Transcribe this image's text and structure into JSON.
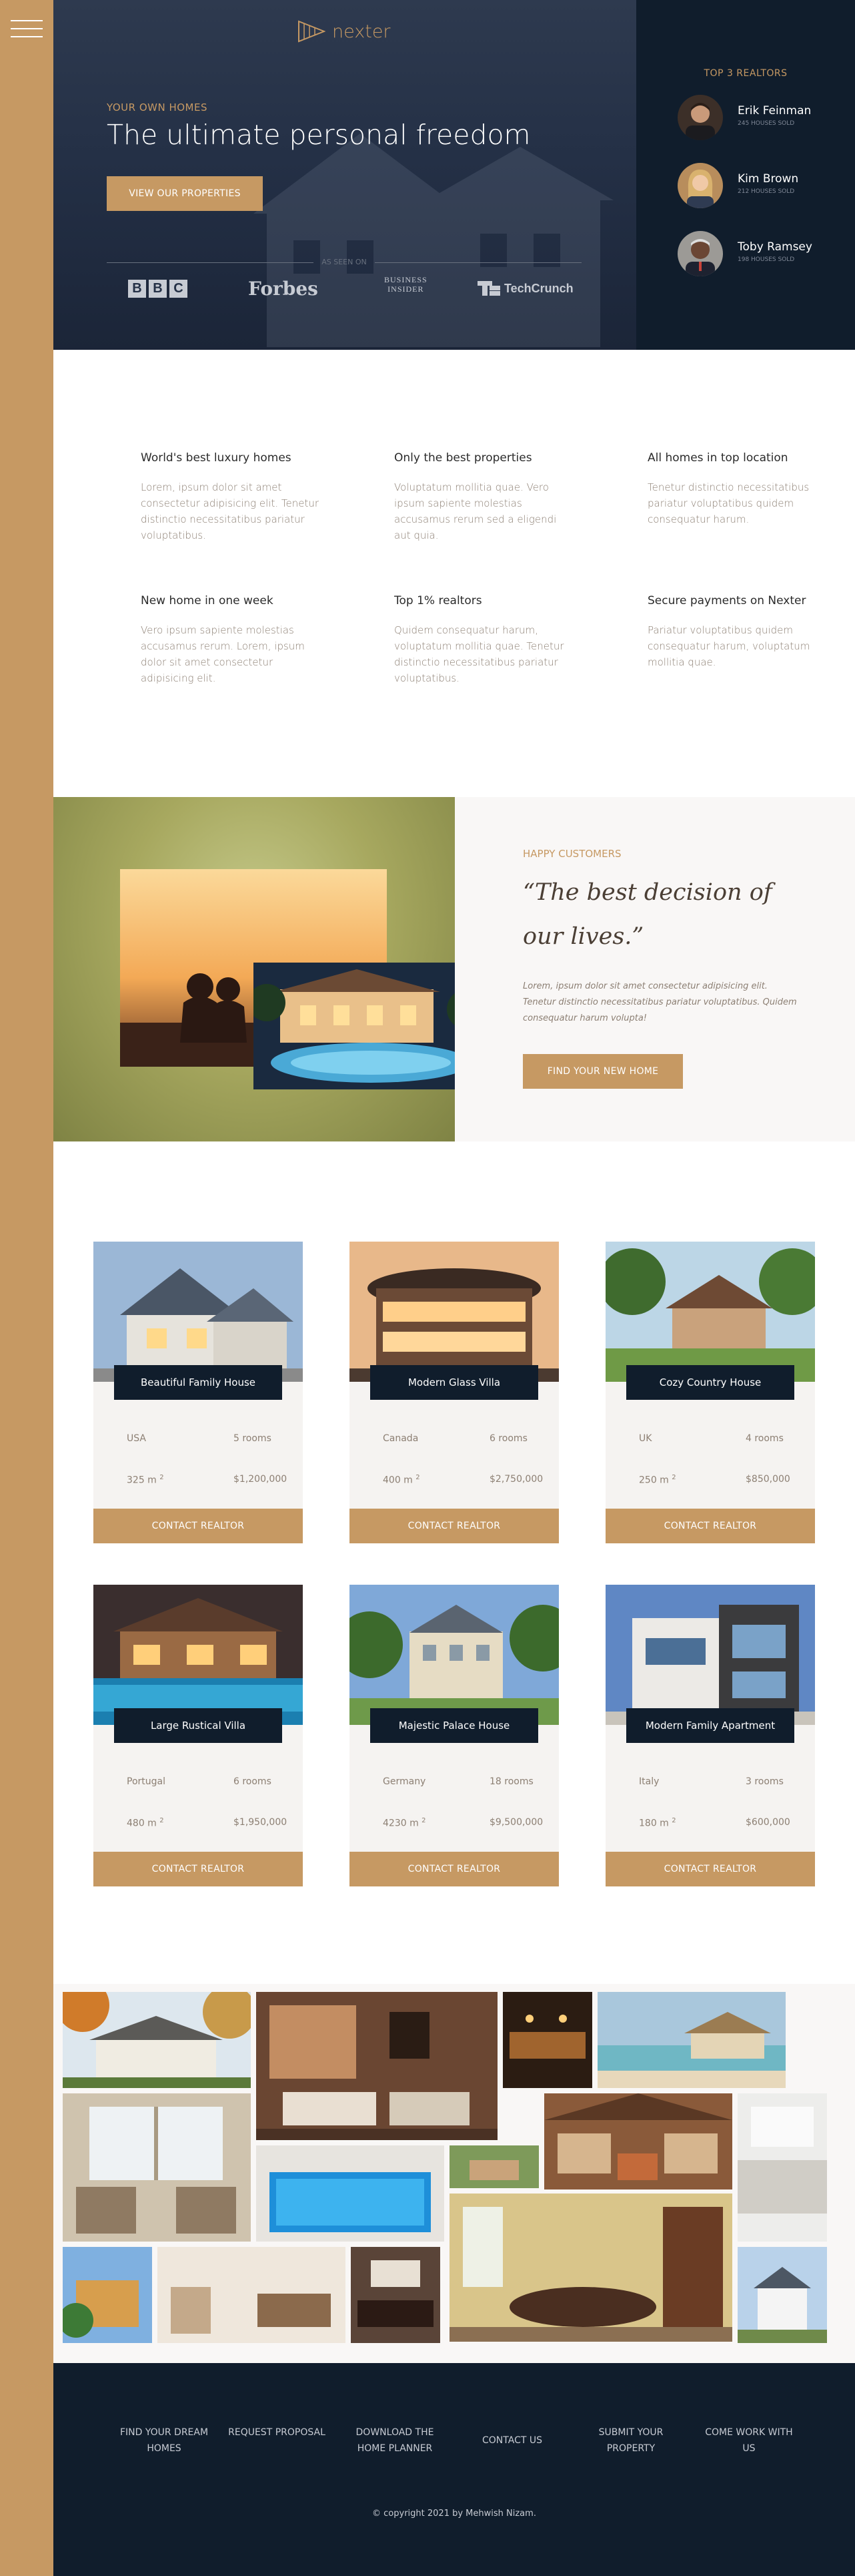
{
  "brand": {
    "name": "nexter",
    "accent": "#c69963",
    "dark": "#101d2c"
  },
  "header": {
    "tagline": "YOUR OWN HOMES",
    "title": "The ultimate personal freedom",
    "cta": "VIEW OUR PROPERTIES",
    "seen_on": "AS SEEN ON",
    "press": [
      "BBC",
      "Forbes",
      "BUSINESS INSIDER",
      "TechCrunch"
    ]
  },
  "realtors": {
    "title": "TOP 3 REALTORS",
    "list": [
      {
        "name": "Erik Feinman",
        "sold": "245 HOUSES SOLD"
      },
      {
        "name": "Kim Brown",
        "sold": "212 HOUSES SOLD"
      },
      {
        "name": "Toby Ramsey",
        "sold": "198 HOUSES SOLD"
      }
    ]
  },
  "features": [
    {
      "title": "World's best luxury homes",
      "text": "Lorem, ipsum dolor sit amet consectetur adipisicing elit. Tenetur distinctio necessitatibus pariatur voluptatibus."
    },
    {
      "title": "Only the best properties",
      "text": "Voluptatum mollitia quae. Vero ipsum sapiente molestias accusamus rerum sed a eligendi aut quia."
    },
    {
      "title": "All homes in top location",
      "text": "Tenetur distinctio necessitatibus pariatur voluptatibus quidem consequatur harum."
    },
    {
      "title": "New home in one week",
      "text": "Vero ipsum sapiente molestias accusamus rerum. Lorem, ipsum dolor sit amet consectetur adipisicing elit."
    },
    {
      "title": "Top 1% realtors",
      "text": "Quidem consequatur harum, voluptatum mollitia quae. Tenetur distinctio necessitatibus pariatur voluptatibus."
    },
    {
      "title": "Secure payments on Nexter",
      "text": "Pariatur voluptatibus quidem consequatur harum, voluptatum mollitia quae."
    }
  ],
  "story": {
    "tag": "HAPPY CUSTOMERS",
    "quote": "“The best decision of our lives.”",
    "body": "Lorem, ipsum dolor sit amet consectetur adipisicing elit. Tenetur distinctio necessitatibus pariatur voluptatibus. Quidem consequatur harum volupta!",
    "cta": "FIND YOUR NEW HOME"
  },
  "homes": [
    {
      "name": "Beautiful Family House",
      "country": "USA",
      "rooms": "5 rooms",
      "area": "325 m",
      "price": "$1,200,000"
    },
    {
      "name": "Modern Glass Villa",
      "country": "Canada",
      "rooms": "6 rooms",
      "area": "400 m",
      "price": "$2,750,000"
    },
    {
      "name": "Cozy Country House",
      "country": "UK",
      "rooms": "4 rooms",
      "area": "250 m",
      "price": "$850,000"
    },
    {
      "name": "Large Rustical Villa",
      "country": "Portugal",
      "rooms": "6 rooms",
      "area": "480 m",
      "price": "$1,950,000"
    },
    {
      "name": "Majestic Palace House",
      "country": "Germany",
      "rooms": "18 rooms",
      "area": "4230 m",
      "price": "$9,500,000"
    },
    {
      "name": "Modern Family Apartment",
      "country": "Italy",
      "rooms": "3 rooms",
      "area": "180 m",
      "price": "$600,000"
    }
  ],
  "home_cta": "CONTACT REALTOR",
  "area_sup": "2",
  "footer": {
    "nav": [
      "FIND YOUR DREAM HOMES",
      "REQUEST PROPOSAL",
      "DOWNLOAD THE HOME PLANNER",
      "CONTACT US",
      "SUBMIT YOUR PROPERTY",
      "COME WORK WITH US"
    ],
    "copyright": "© copyright 2021 by Mehwish Nizam."
  }
}
